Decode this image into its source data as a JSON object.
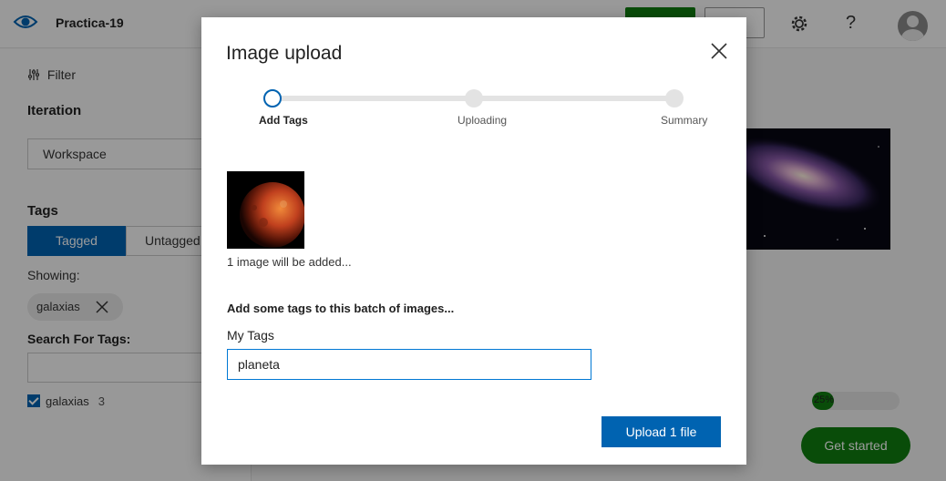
{
  "header": {
    "project_title": "Practica-19",
    "help_glyph": "?"
  },
  "left_panel": {
    "filter_label": "Filter",
    "iteration_label": "Iteration",
    "iteration_value": "Workspace",
    "tags_label": "Tags",
    "tab_tagged": "Tagged",
    "tab_untagged": "Untagged",
    "showing_label": "Showing:",
    "chip_label": "galaxias",
    "search_label": "Search For Tags:",
    "search_value": "",
    "tag_list": [
      {
        "name": "galaxias",
        "count": "3",
        "checked": true
      }
    ]
  },
  "main": {
    "progress_percent": 25,
    "progress_text": "25%",
    "get_started_label": "Get started"
  },
  "dialog": {
    "title": "Image upload",
    "steps": [
      {
        "label": "Add Tags",
        "active": true
      },
      {
        "label": "Uploading",
        "active": false
      },
      {
        "label": "Summary",
        "active": false
      }
    ],
    "images_info": "1 image will be added...",
    "batch_prompt": "Add some tags to this batch of images...",
    "my_tags_label": "My Tags",
    "my_tags_value": "planeta",
    "upload_button_label": "Upload 1 file"
  },
  "colors": {
    "primary_blue": "#0063b1",
    "accent_green": "#107c10"
  },
  "icons": [
    "eye-logo-icon",
    "filter-icon",
    "gear-icon",
    "help-icon",
    "avatar-icon",
    "remove-chip-icon",
    "checkbox-icon",
    "close-icon"
  ]
}
